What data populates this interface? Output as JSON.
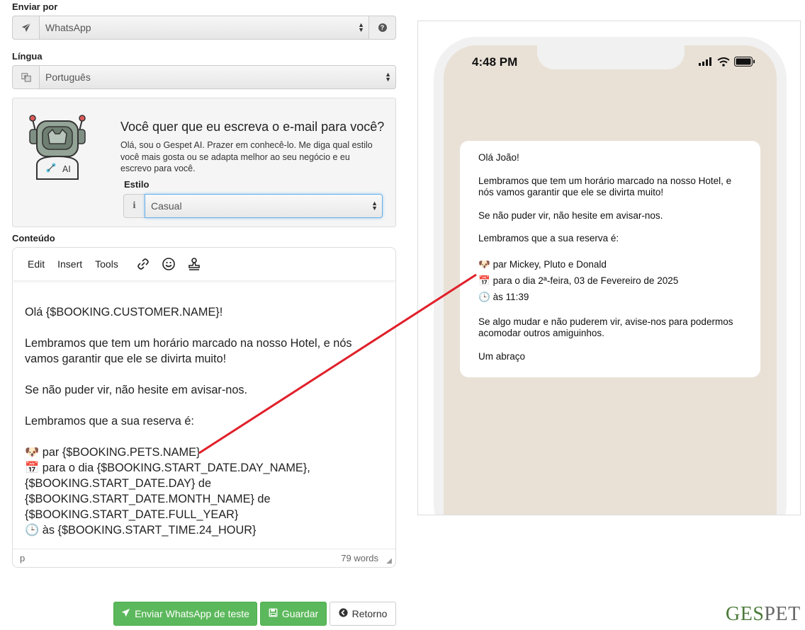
{
  "send_by": {
    "label": "Enviar por",
    "value": "WhatsApp",
    "icon": "paper-plane-icon",
    "help_icon": "question-circle-icon"
  },
  "language": {
    "label": "Língua",
    "value": "Português",
    "icon": "language-icon"
  },
  "ai": {
    "title": "Você quer que eu escreva o e-mail para você?",
    "text": "Olá, sou o Gespet AI. Prazer em conhecê-lo. Me diga qual estilo você mais gosta ou se adapta melhor ao seu negócio e eu escrevo para você.",
    "robot_badge": "AI",
    "style_label": "Estilo",
    "style_value": "Casual",
    "style_icon": "info-icon"
  },
  "content": {
    "label": "Conteúdo",
    "menus": [
      "Edit",
      "Insert",
      "Tools"
    ],
    "lines": {
      "greeting": "Olá {$BOOKING.CUSTOMER.NAME}!",
      "p1": "Lembramos que tem um horário marcado na nosso Hotel, e nós vamos garantir que ele se divirta muito!",
      "p2": "Se não puder vir, não hesite em avisar-nos.",
      "p3": "Lembramos que a sua reserva é:",
      "pets_emoji": "🐶",
      "pets": " par {$BOOKING.PETS.NAME}",
      "date_emoji": "📅",
      "date": " para o dia {$BOOKING.START_DATE.DAY_NAME}, {$BOOKING.START_DATE.DAY} de {$BOOKING.START_DATE.MONTH_NAME} de {$BOOKING.START_DATE.FULL_YEAR}",
      "time_emoji": "🕒",
      "time": " às {$BOOKING.START_TIME.24_HOUR}"
    },
    "status_path": "p",
    "word_count": "79 words"
  },
  "buttons": {
    "test": "Enviar WhatsApp de teste",
    "save": "Guardar",
    "back": "Retorno"
  },
  "brand": {
    "ge": "GES",
    "pet": "PET"
  },
  "preview": {
    "time": "4:48 PM",
    "greeting": "Olá João!",
    "p1": "Lembramos que tem um horário marcado na nosso Hotel, e nós vamos garantir que ele se divirta muito!",
    "p2": "Se não puder vir, não hesite em avisar-nos.",
    "p3": "Lembramos que a sua reserva é:",
    "pets": " par Mickey, Pluto e Donald",
    "date": " para o dia 2ª-feira, 03 de Fevereiro de 2025",
    "time_line": " às 11:39",
    "p4": "Se algo mudar e não puderem vir, avise-nos para podermos acomodar outros amiguinhos.",
    "closing": "Um abraço"
  },
  "colors": {
    "green_button": "#5cb85c",
    "arrow": "#e0202a",
    "chat_background": "#e9e1d6"
  }
}
